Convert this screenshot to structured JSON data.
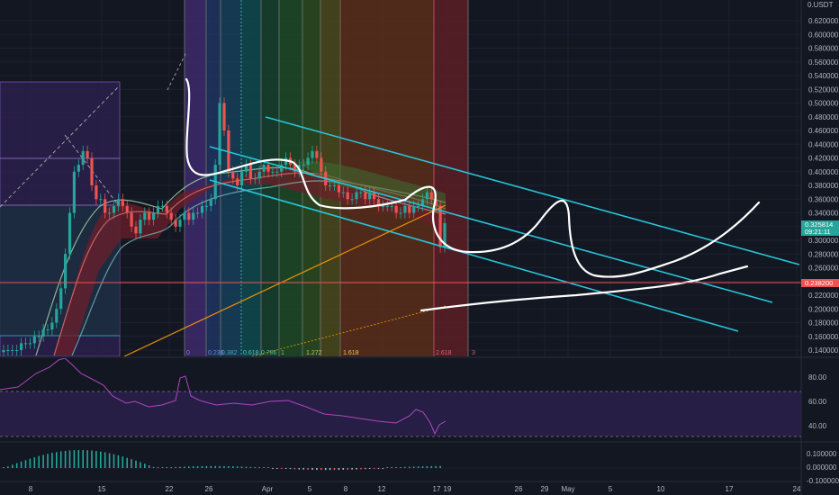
{
  "chart_data": {
    "type": "candlestick",
    "quote_currency": "USDT",
    "x_axis": {
      "tick_labels": [
        "8",
        "15",
        "22",
        "26",
        "Apr",
        "5",
        "8",
        "12",
        "17",
        "19",
        "26",
        "29",
        "May",
        "5",
        "10",
        "17",
        "24"
      ]
    },
    "price_pane": {
      "y_axis_label": "0.USDT",
      "ylim": [
        0.13,
        0.64
      ],
      "y_ticks": [
        "0.620000",
        "0.600000",
        "0.580000",
        "0.560000",
        "0.540000",
        "0.520000",
        "0.500000",
        "0.480000",
        "0.460000",
        "0.440000",
        "0.420000",
        "0.400000",
        "0.380000",
        "0.360000",
        "0.340000",
        "0.320000",
        "0.300000",
        "0.280000",
        "0.260000",
        "0.240000",
        "0.220000",
        "0.200000",
        "0.180000",
        "0.160000",
        "0.140000"
      ],
      "current_price_tag": {
        "value": "0.325814",
        "countdown": "09:21:11",
        "color": "#26a69a"
      },
      "horizontal_line_tag": {
        "value": "0.238200",
        "color": "#ef5350"
      },
      "fib_time_labels": [
        "0",
        "0.236",
        "0.382",
        "0.618",
        "0.786",
        "1",
        "1.272",
        "1.618",
        "2.618",
        "3"
      ],
      "candles_close_approx": [
        0.14,
        0.14,
        0.14,
        0.14,
        0.15,
        0.15,
        0.15,
        0.16,
        0.16,
        0.17,
        0.17,
        0.18,
        0.2,
        0.23,
        0.28,
        0.34,
        0.4,
        0.41,
        0.43,
        0.42,
        0.38,
        0.36,
        0.36,
        0.34,
        0.34,
        0.35,
        0.36,
        0.35,
        0.34,
        0.32,
        0.31,
        0.33,
        0.34,
        0.33,
        0.34,
        0.35,
        0.35,
        0.34,
        0.33,
        0.32,
        0.33,
        0.34,
        0.33,
        0.34,
        0.34,
        0.35,
        0.35,
        0.36,
        0.41,
        0.5,
        0.46,
        0.4,
        0.39,
        0.38,
        0.4,
        0.41,
        0.39,
        0.39,
        0.4,
        0.41,
        0.4,
        0.4,
        0.4,
        0.41,
        0.42,
        0.41,
        0.4,
        0.41,
        0.41,
        0.42,
        0.43,
        0.42,
        0.4,
        0.38,
        0.38,
        0.38,
        0.37,
        0.37,
        0.36,
        0.36,
        0.37,
        0.37,
        0.36,
        0.37,
        0.36,
        0.35,
        0.35,
        0.35,
        0.35,
        0.34,
        0.34,
        0.35,
        0.34,
        0.35,
        0.35,
        0.36,
        0.37,
        0.36,
        0.35,
        0.29,
        0.325
      ]
    },
    "rsi_pane": {
      "ylim": [
        0,
        100
      ],
      "y_ticks": [
        "80.00",
        "60.00",
        "40.00"
      ],
      "band": [
        30,
        70
      ]
    },
    "histogram_pane": {
      "ylim": [
        -0.1,
        0.1
      ],
      "y_ticks": [
        "0.100000",
        "0.000000",
        "-0.100000"
      ]
    }
  }
}
